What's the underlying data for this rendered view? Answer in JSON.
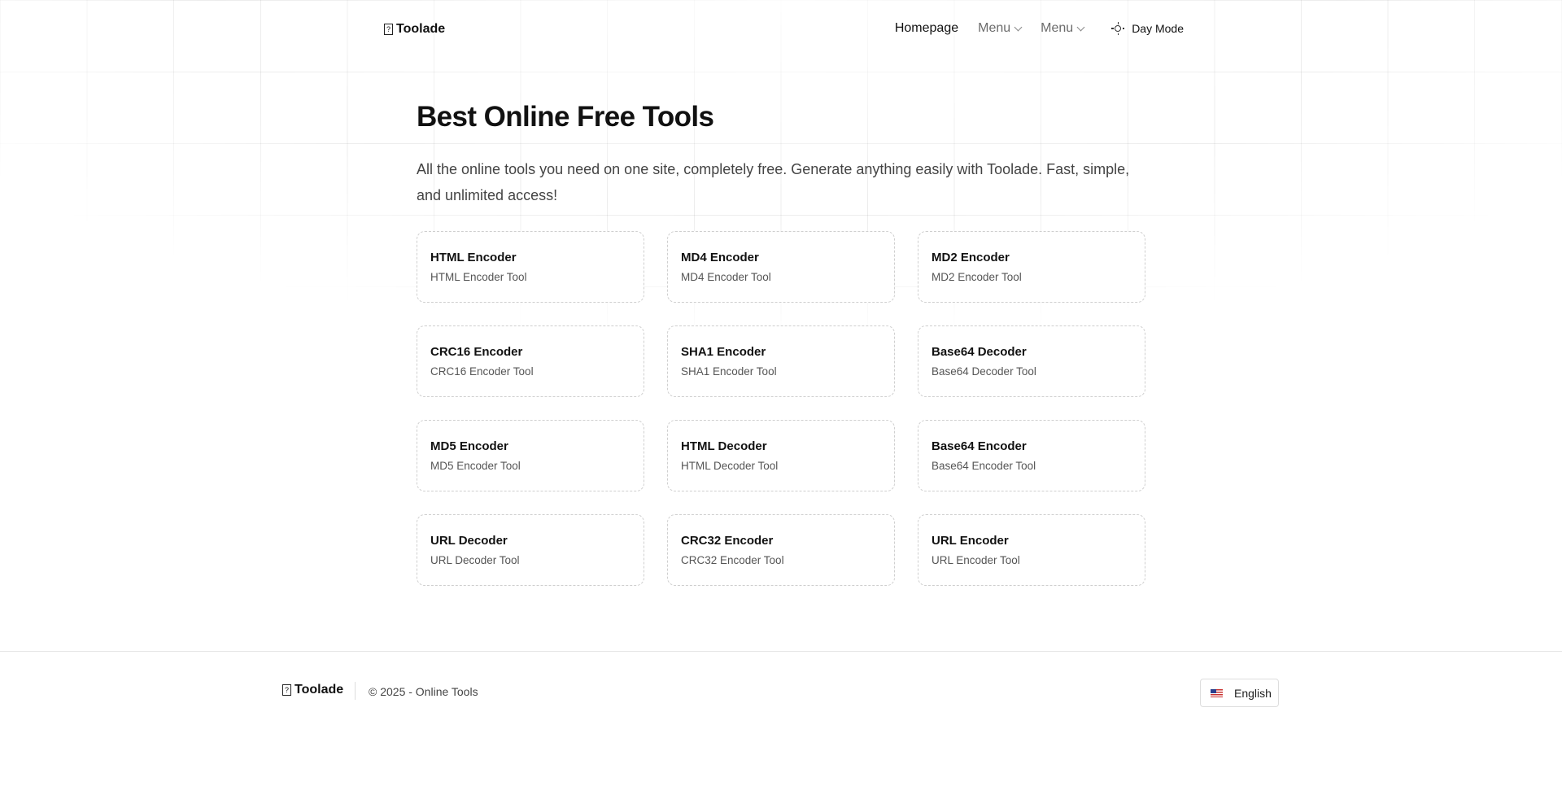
{
  "header": {
    "logo_icon": "?",
    "logo_text": "Toolade",
    "nav": {
      "homepage": "Homepage",
      "menu1": "Menu",
      "menu2": "Menu",
      "day_mode": "Day Mode"
    }
  },
  "hero": {
    "title": "Best Online Free Tools",
    "description": "All the online tools you need on one site, completely free. Generate anything easily with Toolade. Fast, simple, and unlimited access!"
  },
  "tools": [
    {
      "title": "HTML Encoder",
      "subtitle": "HTML Encoder Tool"
    },
    {
      "title": "MD4 Encoder",
      "subtitle": "MD4 Encoder Tool"
    },
    {
      "title": "MD2 Encoder",
      "subtitle": "MD2 Encoder Tool"
    },
    {
      "title": "CRC16 Encoder",
      "subtitle": "CRC16 Encoder Tool"
    },
    {
      "title": "SHA1 Encoder",
      "subtitle": "SHA1 Encoder Tool"
    },
    {
      "title": "Base64 Decoder",
      "subtitle": "Base64 Decoder Tool"
    },
    {
      "title": "MD5 Encoder",
      "subtitle": "MD5 Encoder Tool"
    },
    {
      "title": "HTML Decoder",
      "subtitle": "HTML Decoder Tool"
    },
    {
      "title": "Base64 Encoder",
      "subtitle": "Base64 Encoder Tool"
    },
    {
      "title": "URL Decoder",
      "subtitle": "URL Decoder Tool"
    },
    {
      "title": "CRC32 Encoder",
      "subtitle": "CRC32 Encoder Tool"
    },
    {
      "title": "URL Encoder",
      "subtitle": "URL Encoder Tool"
    }
  ],
  "footer": {
    "logo_icon": "?",
    "logo_text": "Toolade",
    "copyright": "© 2025 - Online Tools",
    "language": "English",
    "language_flag": "us-flag-icon"
  },
  "icons": {
    "theme": "sun-icon",
    "dropdown": "chevron-down-icon"
  }
}
